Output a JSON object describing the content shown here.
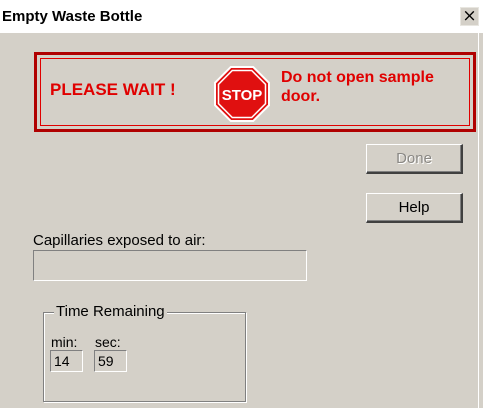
{
  "window": {
    "title": "Empty Waste Bottle",
    "close_label": "×"
  },
  "warning": {
    "please_wait": "PLEASE WAIT !",
    "stop_sign_text": "STOP",
    "message": "Do not open sample door."
  },
  "buttons": {
    "done_label": "Done",
    "done_enabled": false,
    "help_label": "Help"
  },
  "capillaries": {
    "label": "Capillaries exposed to air:",
    "value": ""
  },
  "time_remaining": {
    "legend": "Time Remaining",
    "min_label": "min:",
    "sec_label": "sec:",
    "min_value": "14",
    "sec_value": "59"
  },
  "colors": {
    "dialog_bg": "#d4d0c8",
    "warning_red": "#e00000",
    "stop_sign_red": "#e01010"
  },
  "icons": {
    "stop_sign": "stop-sign-icon"
  }
}
